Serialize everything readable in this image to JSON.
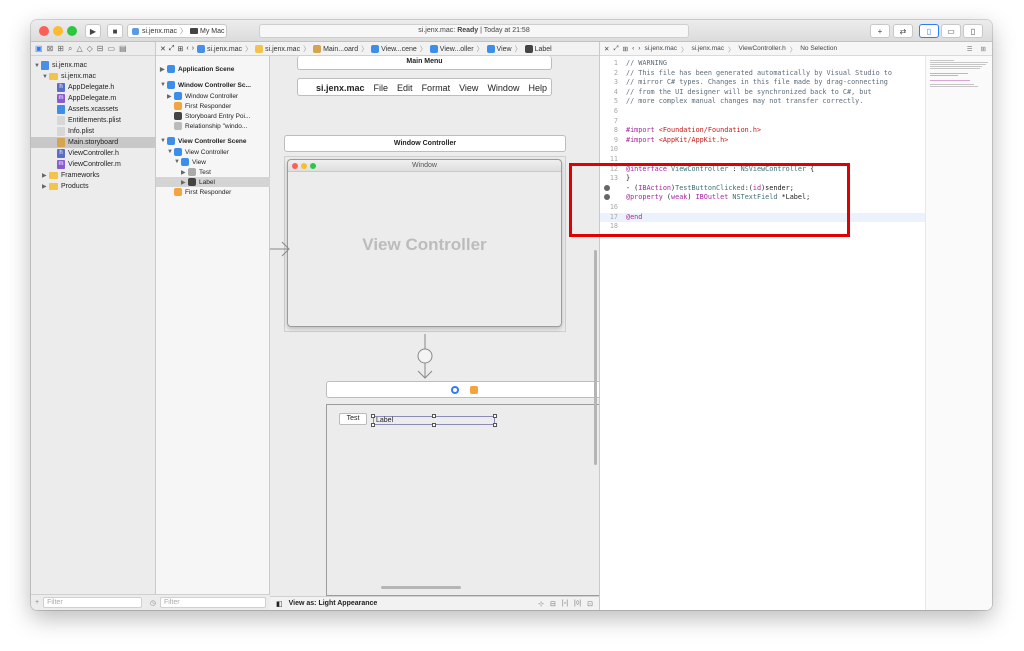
{
  "toolbar": {
    "scheme": "si.jenx.mac",
    "destination": "My Mac",
    "status_project": "si.jenx.mac:",
    "status_state": "Ready",
    "status_time": "| Today at 21:58"
  },
  "navigator": {
    "items": [
      {
        "label": "si.jenx.mac",
        "level": 0,
        "type": "project"
      },
      {
        "label": "si.jenx.mac",
        "level": 1,
        "type": "folder"
      },
      {
        "label": "AppDelegate.h",
        "level": 2,
        "type": "h"
      },
      {
        "label": "AppDelegate.m",
        "level": 2,
        "type": "m"
      },
      {
        "label": "Assets.xcassets",
        "level": 2,
        "type": "assets"
      },
      {
        "label": "Entitlements.plist",
        "level": 2,
        "type": "plist"
      },
      {
        "label": "Info.plist",
        "level": 2,
        "type": "plist"
      },
      {
        "label": "Main.storyboard",
        "level": 2,
        "type": "storyboard"
      },
      {
        "label": "ViewController.h",
        "level": 2,
        "type": "h"
      },
      {
        "label": "ViewController.m",
        "level": 2,
        "type": "m"
      },
      {
        "label": "Frameworks",
        "level": 1,
        "type": "folder"
      },
      {
        "label": "Products",
        "level": 1,
        "type": "folder"
      }
    ],
    "filter_placeholder": "Filter"
  },
  "outline": {
    "items": [
      {
        "label": "Application Scene",
        "level": 0,
        "bold": true
      },
      {
        "label": "Window Controller Sc...",
        "level": 0,
        "bold": true
      },
      {
        "label": "Window Controller",
        "level": 1
      },
      {
        "label": "First Responder",
        "level": 1
      },
      {
        "label": "Storyboard Entry Poi...",
        "level": 1
      },
      {
        "label": "Relationship \"windo...",
        "level": 1
      },
      {
        "label": "View Controller Scene",
        "level": 0,
        "bold": true
      },
      {
        "label": "View Controller",
        "level": 1
      },
      {
        "label": "View",
        "level": 2
      },
      {
        "label": "Test",
        "level": 3
      },
      {
        "label": "Label",
        "level": 3
      },
      {
        "label": "First Responder",
        "level": 1
      }
    ],
    "filter_placeholder": "Filter"
  },
  "jumpbar": {
    "crumbs": [
      "si.jenx.mac",
      "si.jenx.mac",
      "Main...oard",
      "View...cene",
      "View...oller",
      "View",
      "Label"
    ]
  },
  "canvas": {
    "main_menu_title": "Main Menu",
    "menu_items": [
      "si.jenx.mac",
      "File",
      "Edit",
      "Format",
      "View",
      "Window",
      "Help"
    ],
    "window_controller_title": "Window Controller",
    "window_title": "Window",
    "view_controller_label": "View Controller",
    "test_button": "Test",
    "label_text": "Label",
    "view_as": "View as: Light Appearance"
  },
  "editor": {
    "crumbs": [
      "si.jenx.mac",
      "si.jenx.mac",
      "ViewController.h",
      "No Selection"
    ],
    "lines": [
      {
        "n": "1",
        "parts": [
          {
            "c": "cmt",
            "t": "// WARNING"
          }
        ]
      },
      {
        "n": "2",
        "parts": [
          {
            "c": "cmt",
            "t": "// This file has been generated automatically by Visual Studio to"
          }
        ]
      },
      {
        "n": "3",
        "parts": [
          {
            "c": "cmt",
            "t": "// mirror C# types. Changes in this file made by drag-connecting"
          }
        ]
      },
      {
        "n": "4",
        "parts": [
          {
            "c": "cmt",
            "t": "// from the UI designer will be synchronized back to C#, but"
          }
        ]
      },
      {
        "n": "5",
        "parts": [
          {
            "c": "cmt",
            "t": "// more complex manual changes may not transfer correctly."
          }
        ]
      },
      {
        "n": "6",
        "parts": []
      },
      {
        "n": "7",
        "parts": []
      },
      {
        "n": "8",
        "parts": [
          {
            "c": "kw",
            "t": "#import "
          },
          {
            "c": "str",
            "t": "<Foundation/Foundation.h>"
          }
        ]
      },
      {
        "n": "9",
        "parts": [
          {
            "c": "kw",
            "t": "#import "
          },
          {
            "c": "str",
            "t": "<AppKit/AppKit.h>"
          }
        ]
      },
      {
        "n": "10",
        "parts": []
      },
      {
        "n": "11",
        "parts": []
      },
      {
        "n": "12",
        "parts": [
          {
            "c": "kw",
            "t": "@interface "
          },
          {
            "c": "typ",
            "t": "ViewController"
          },
          {
            "c": "plain",
            "t": " : "
          },
          {
            "c": "typ",
            "t": "NSViewController"
          },
          {
            "c": "plain",
            "t": " {"
          }
        ]
      },
      {
        "n": "13",
        "parts": [
          {
            "c": "plain",
            "t": "}"
          }
        ]
      },
      {
        "n": "",
        "conn": true,
        "parts": [
          {
            "c": "plain",
            "t": "- ("
          },
          {
            "c": "kw",
            "t": "IBAction"
          },
          {
            "c": "plain",
            "t": ")"
          },
          {
            "c": "typ",
            "t": "TestButtonClicked"
          },
          {
            "c": "plain",
            "t": ":("
          },
          {
            "c": "kw",
            "t": "id"
          },
          {
            "c": "plain",
            "t": ")sender;"
          }
        ]
      },
      {
        "n": "",
        "conn": true,
        "parts": [
          {
            "c": "kw",
            "t": "@property "
          },
          {
            "c": "plain",
            "t": "("
          },
          {
            "c": "kw",
            "t": "weak"
          },
          {
            "c": "plain",
            "t": ") "
          },
          {
            "c": "kw",
            "t": "IBOutlet "
          },
          {
            "c": "typ",
            "t": "NSTextField"
          },
          {
            "c": "plain",
            "t": " *Label;"
          }
        ]
      },
      {
        "n": "16",
        "parts": []
      },
      {
        "n": "17",
        "current": true,
        "parts": [
          {
            "c": "kw",
            "t": "@end"
          }
        ]
      },
      {
        "n": "18",
        "parts": []
      }
    ]
  },
  "colors": {
    "accent": "#2f7cf6",
    "highlight": "#e00000"
  }
}
